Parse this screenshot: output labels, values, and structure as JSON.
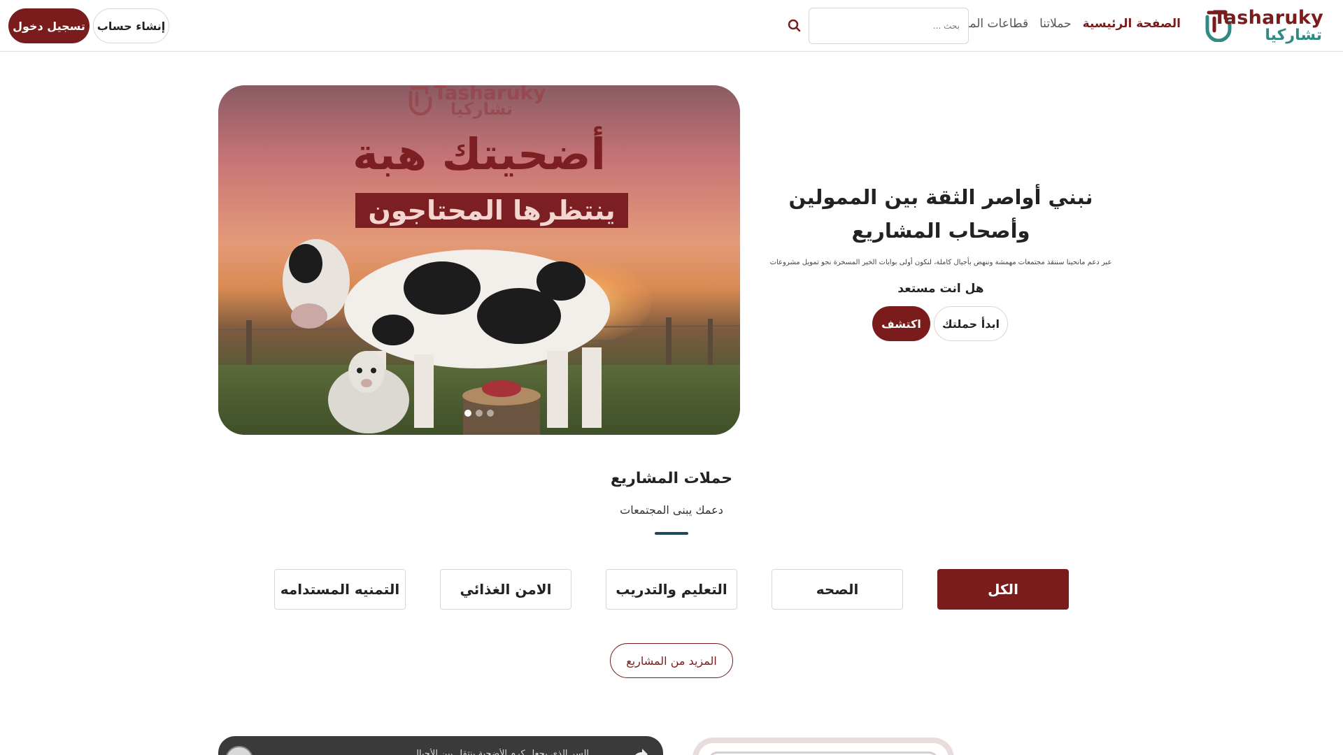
{
  "brand": {
    "name_latin": "Tasharuky",
    "name_arabic": "تشاركيا",
    "color_primary": "#7a1c1c",
    "color_accent": "#2f8a84"
  },
  "nav": {
    "items": [
      {
        "label": "الصفحة الرئيسية",
        "active": true
      },
      {
        "label": "حملاتنا",
        "active": false
      },
      {
        "label": "قطاعات المشاريع",
        "active": false
      }
    ]
  },
  "search": {
    "placeholder": "بحث ..."
  },
  "auth": {
    "signup_label": "إنشاء حساب",
    "login_label": "تسجيل دخول"
  },
  "slider": {
    "headline": "أضحيتك هبة",
    "subline": "ينتظرها المحتاجون",
    "logo_latin": "Tasharuky",
    "logo_arabic": "تشاركيا",
    "dots": 3,
    "active_dot": 1
  },
  "hero": {
    "title": "نبني أواصر الثقة بين الممولين وأصحاب المشاريع",
    "subtitle": "عبر دعم مانحينا سننقذ مجتمعات مهمشة وننهض بأجيال كاملة، لنكون أولى بوابات الخير المسخرة نحو تمويل مشروعات",
    "question": "هل انت مستعد",
    "discover_label": "اكتشف",
    "start_label": "ابدأ حملتك"
  },
  "campaigns": {
    "title": "حملات المشاريع",
    "subtitle": "دعمك يبنى المجتمعات",
    "tabs": [
      {
        "label": "الكل",
        "active": true
      },
      {
        "label": "الصحه",
        "active": false
      },
      {
        "label": "التعليم والتدريب",
        "active": false
      },
      {
        "label": "الامن الغذائي",
        "active": false
      },
      {
        "label": "التمنيه المستدامه",
        "active": false
      }
    ],
    "more_label": "المزيد من المشاريع"
  },
  "video": {
    "title": "السر الذي يجعل كرم الأضحية ينتقل بين الأجيال..."
  }
}
